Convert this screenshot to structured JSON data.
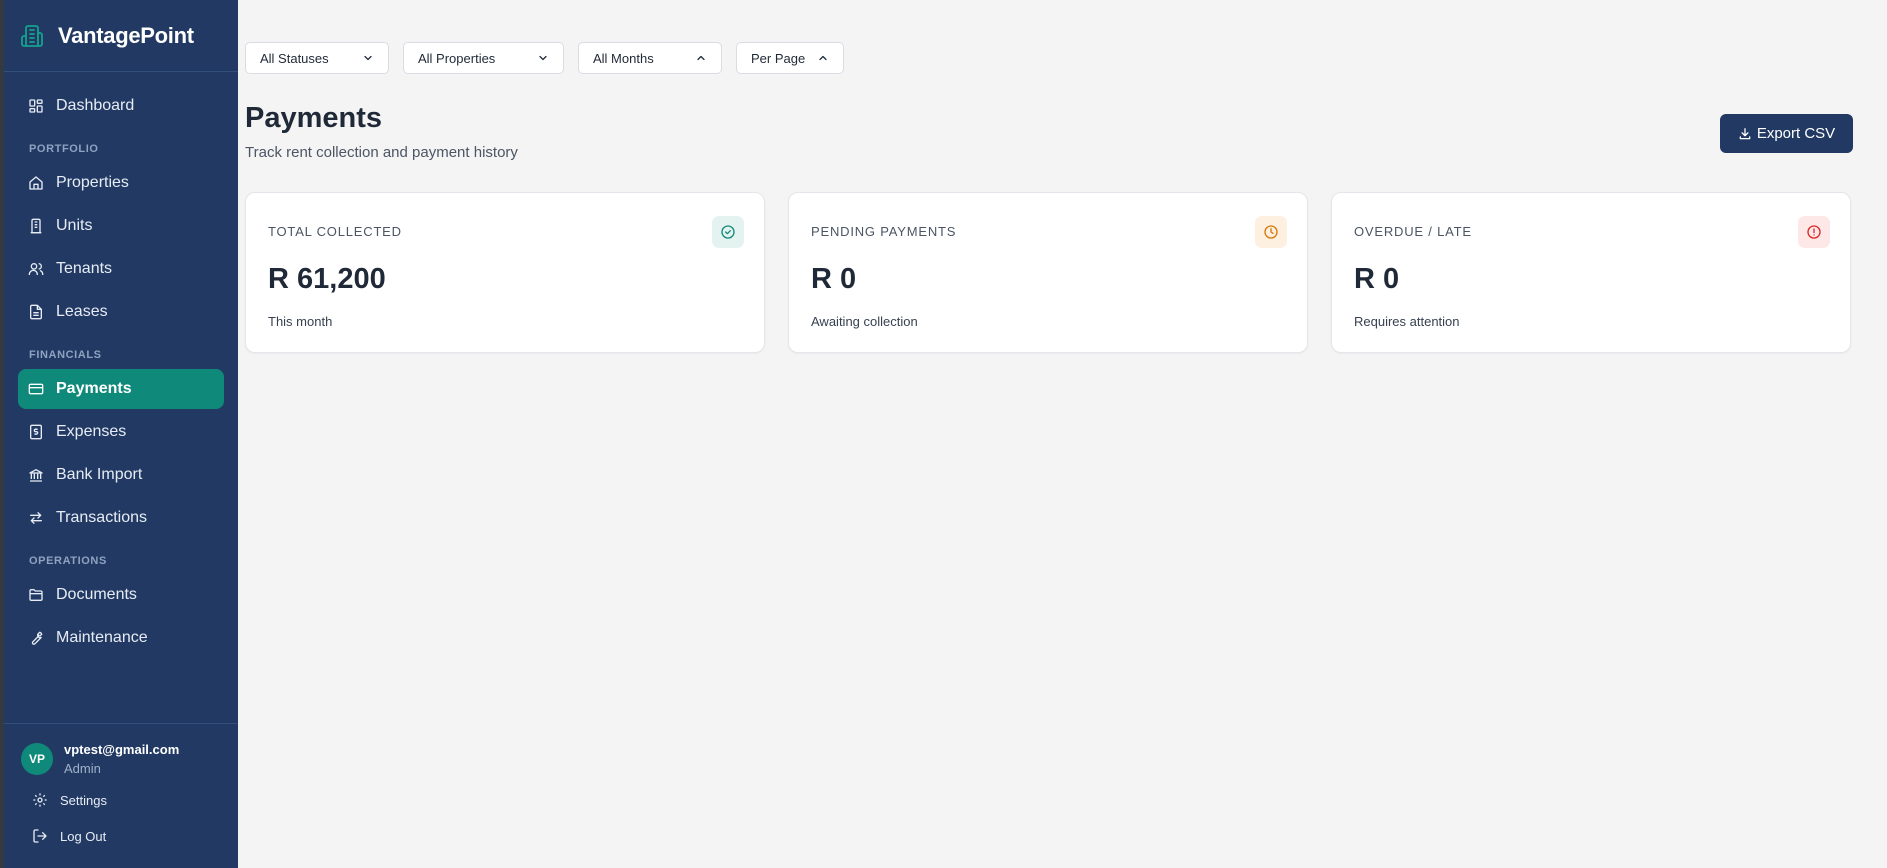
{
  "brand": {
    "name": "VantagePoint",
    "icon": "building-icon",
    "accent": "#0f8a7a"
  },
  "sidebar": {
    "items": [
      {
        "label": "Dashboard",
        "icon": "dashboard-icon"
      },
      {
        "section": "PORTFOLIO"
      },
      {
        "label": "Properties",
        "icon": "home-icon"
      },
      {
        "label": "Units",
        "icon": "building-icon"
      },
      {
        "label": "Tenants",
        "icon": "users-icon"
      },
      {
        "label": "Leases",
        "icon": "file-icon"
      },
      {
        "section": "FINANCIALS"
      },
      {
        "label": "Payments",
        "icon": "credit-card-icon",
        "active": true
      },
      {
        "label": "Expenses",
        "icon": "receipt-icon"
      },
      {
        "label": "Bank Import",
        "icon": "bank-icon"
      },
      {
        "label": "Transactions",
        "icon": "arrows-icon"
      },
      {
        "section": "OPERATIONS"
      },
      {
        "label": "Documents",
        "icon": "folder-icon"
      },
      {
        "label": "Maintenance",
        "icon": "wrench-icon"
      }
    ],
    "labels": {
      "dashboard": "Dashboard",
      "portfolio": "PORTFOLIO",
      "properties": "Properties",
      "units": "Units",
      "tenants": "Tenants",
      "leases": "Leases",
      "financials": "FINANCIALS",
      "payments": "Payments",
      "expenses": "Expenses",
      "bank_import": "Bank Import",
      "transactions": "Transactions",
      "operations": "OPERATIONS",
      "documents": "Documents",
      "maintenance": "Maintenance"
    }
  },
  "user": {
    "initials": "VP",
    "email": "vptest@gmail.com",
    "role": "Admin",
    "settings_label": "Settings",
    "logout_label": "Log Out"
  },
  "filters": {
    "status": "All Statuses",
    "property": "All Properties",
    "month": "All Months",
    "per_page": "Per Page"
  },
  "header": {
    "title": "Payments",
    "subtitle": "Track rent collection and payment history",
    "export_label": "Export CSV"
  },
  "cards": [
    {
      "label": "TOTAL COLLECTED",
      "value": "R 61,200",
      "note": "This month",
      "icon": "check-circle-icon",
      "color": "#0f8a7a"
    },
    {
      "label": "PENDING PAYMENTS",
      "value": "R 0",
      "note": "Awaiting collection",
      "icon": "clock-icon",
      "color": "#d97706"
    },
    {
      "label": "OVERDUE / LATE",
      "value": "R 0",
      "note": "Requires attention",
      "icon": "alert-circle-icon",
      "color": "#dc2626"
    }
  ]
}
